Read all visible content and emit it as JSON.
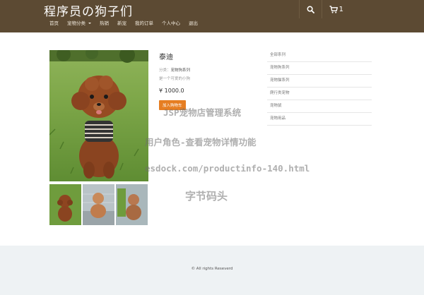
{
  "header": {
    "brand": "程序员の狗子们",
    "cart_count": "1",
    "icons": [
      "search-icon",
      "cart-icon"
    ],
    "bg_color": "#5c4a33"
  },
  "menu": {
    "items": [
      {
        "label": "首页"
      },
      {
        "label": "宠物分类",
        "dropdown": true
      },
      {
        "label": "热销"
      },
      {
        "label": "新宠"
      },
      {
        "label": "我的订单"
      },
      {
        "label": "个人中心"
      },
      {
        "label": "退出"
      }
    ]
  },
  "product": {
    "name": "泰迪",
    "category_label": "分类：",
    "category_value": "宠物狗系列",
    "description": "是一个可爱的小狗",
    "price": "¥ 1000.0",
    "buy_label": "加入购物车",
    "buy_color": "#e67e22"
  },
  "sidebar": {
    "items": [
      {
        "label": "全部系列"
      },
      {
        "label": "宠物狗系列"
      },
      {
        "label": "宠物猫系列"
      },
      {
        "label": "爬行类宠物"
      },
      {
        "label": "宠物鼠"
      },
      {
        "label": "宠物用品"
      }
    ]
  },
  "watermarks": {
    "line1": "JSP宠物店管理系统",
    "line2": "用户角色-查看宠物详情功能",
    "line3": "esdock.com/productinfo-140.html",
    "line4": "字节码头"
  },
  "footer": {
    "copyright": "© All rights Reseverd",
    "bg_color": "#eef2f4"
  }
}
